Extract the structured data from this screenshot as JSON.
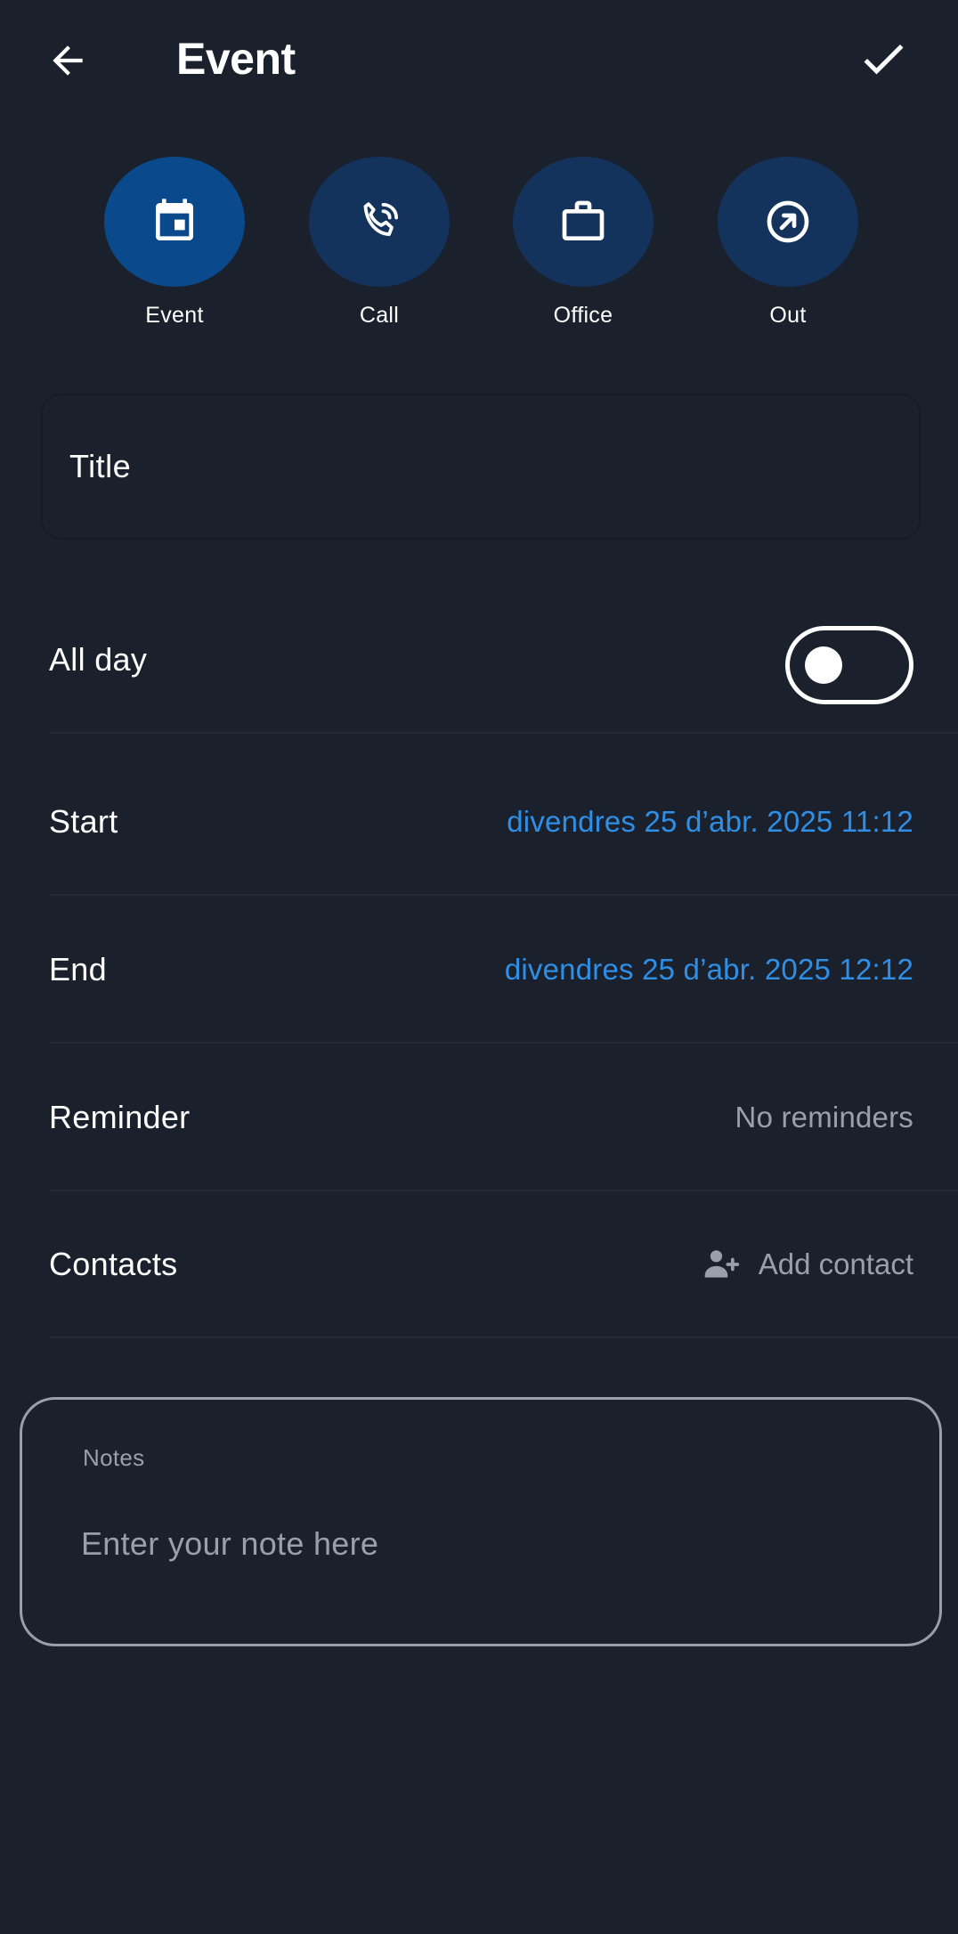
{
  "header": {
    "title": "Event"
  },
  "event_types": [
    {
      "label": "Event",
      "icon": "calendar-icon",
      "selected": true
    },
    {
      "label": "Call",
      "icon": "phone-call-icon",
      "selected": false
    },
    {
      "label": "Office",
      "icon": "briefcase-icon",
      "selected": false
    },
    {
      "label": "Out",
      "icon": "arrow-out-icon",
      "selected": false
    }
  ],
  "title_field": {
    "placeholder": "Title",
    "value": ""
  },
  "all_day": {
    "label": "All day",
    "enabled": false
  },
  "start": {
    "label": "Start",
    "value": "divendres 25 d’abr. 2025 11:12"
  },
  "end": {
    "label": "End",
    "value": "divendres 25 d’abr. 2025 12:12"
  },
  "reminder": {
    "label": "Reminder",
    "value": "No reminders"
  },
  "contacts": {
    "label": "Contacts",
    "action": "Add contact",
    "icon": "add-person-icon"
  },
  "notes": {
    "label": "Notes",
    "placeholder": "Enter your note here"
  },
  "colors": {
    "background": "#1b212c",
    "accent": "#2f8fe6",
    "type_selected": "#0a4a8c",
    "type_unselected": "#13325c",
    "muted_text": "#9aa0aa"
  }
}
